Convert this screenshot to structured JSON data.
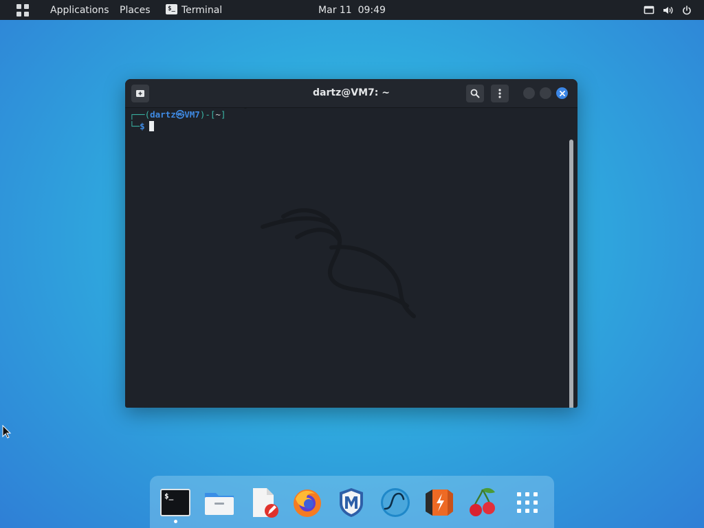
{
  "topbar": {
    "apps_grid_icon": "apps-grid-icon",
    "applications_label": "Applications",
    "places_label": "Places",
    "active_app_label": "Terminal",
    "active_app_icon_text": "$_",
    "clock": "Mar 11  09:49",
    "status_icons": [
      "display-icon",
      "volume-icon",
      "power-icon"
    ]
  },
  "terminal": {
    "title": "dartz@VM7: ~",
    "prompt": {
      "line1_open": "┌──(",
      "user_host": "dartz㉿VM7",
      "line1_mid": ")-[",
      "path": "~",
      "line1_close": "]",
      "line2_corner": "└─",
      "symbol": "$"
    },
    "colors": {
      "frame_green": "#3bb7a7",
      "user_blue": "#3f8ae3",
      "close_button": "#3b86e5",
      "background": "#1e2229"
    }
  },
  "dock": {
    "items": [
      {
        "name": "terminal",
        "icon": "terminal-icon",
        "text": "$_",
        "running": true
      },
      {
        "name": "files",
        "icon": "folder-icon"
      },
      {
        "name": "text-editor",
        "icon": "text-editor-icon"
      },
      {
        "name": "firefox",
        "icon": "firefox-icon"
      },
      {
        "name": "metasploit",
        "icon": "metasploit-icon",
        "text": "M"
      },
      {
        "name": "wireshark",
        "icon": "wireshark-icon"
      },
      {
        "name": "burpsuite",
        "icon": "burpsuite-icon"
      },
      {
        "name": "cherrytree",
        "icon": "cherry-icon"
      },
      {
        "name": "show-applications",
        "icon": "app-grid-icon"
      }
    ]
  }
}
